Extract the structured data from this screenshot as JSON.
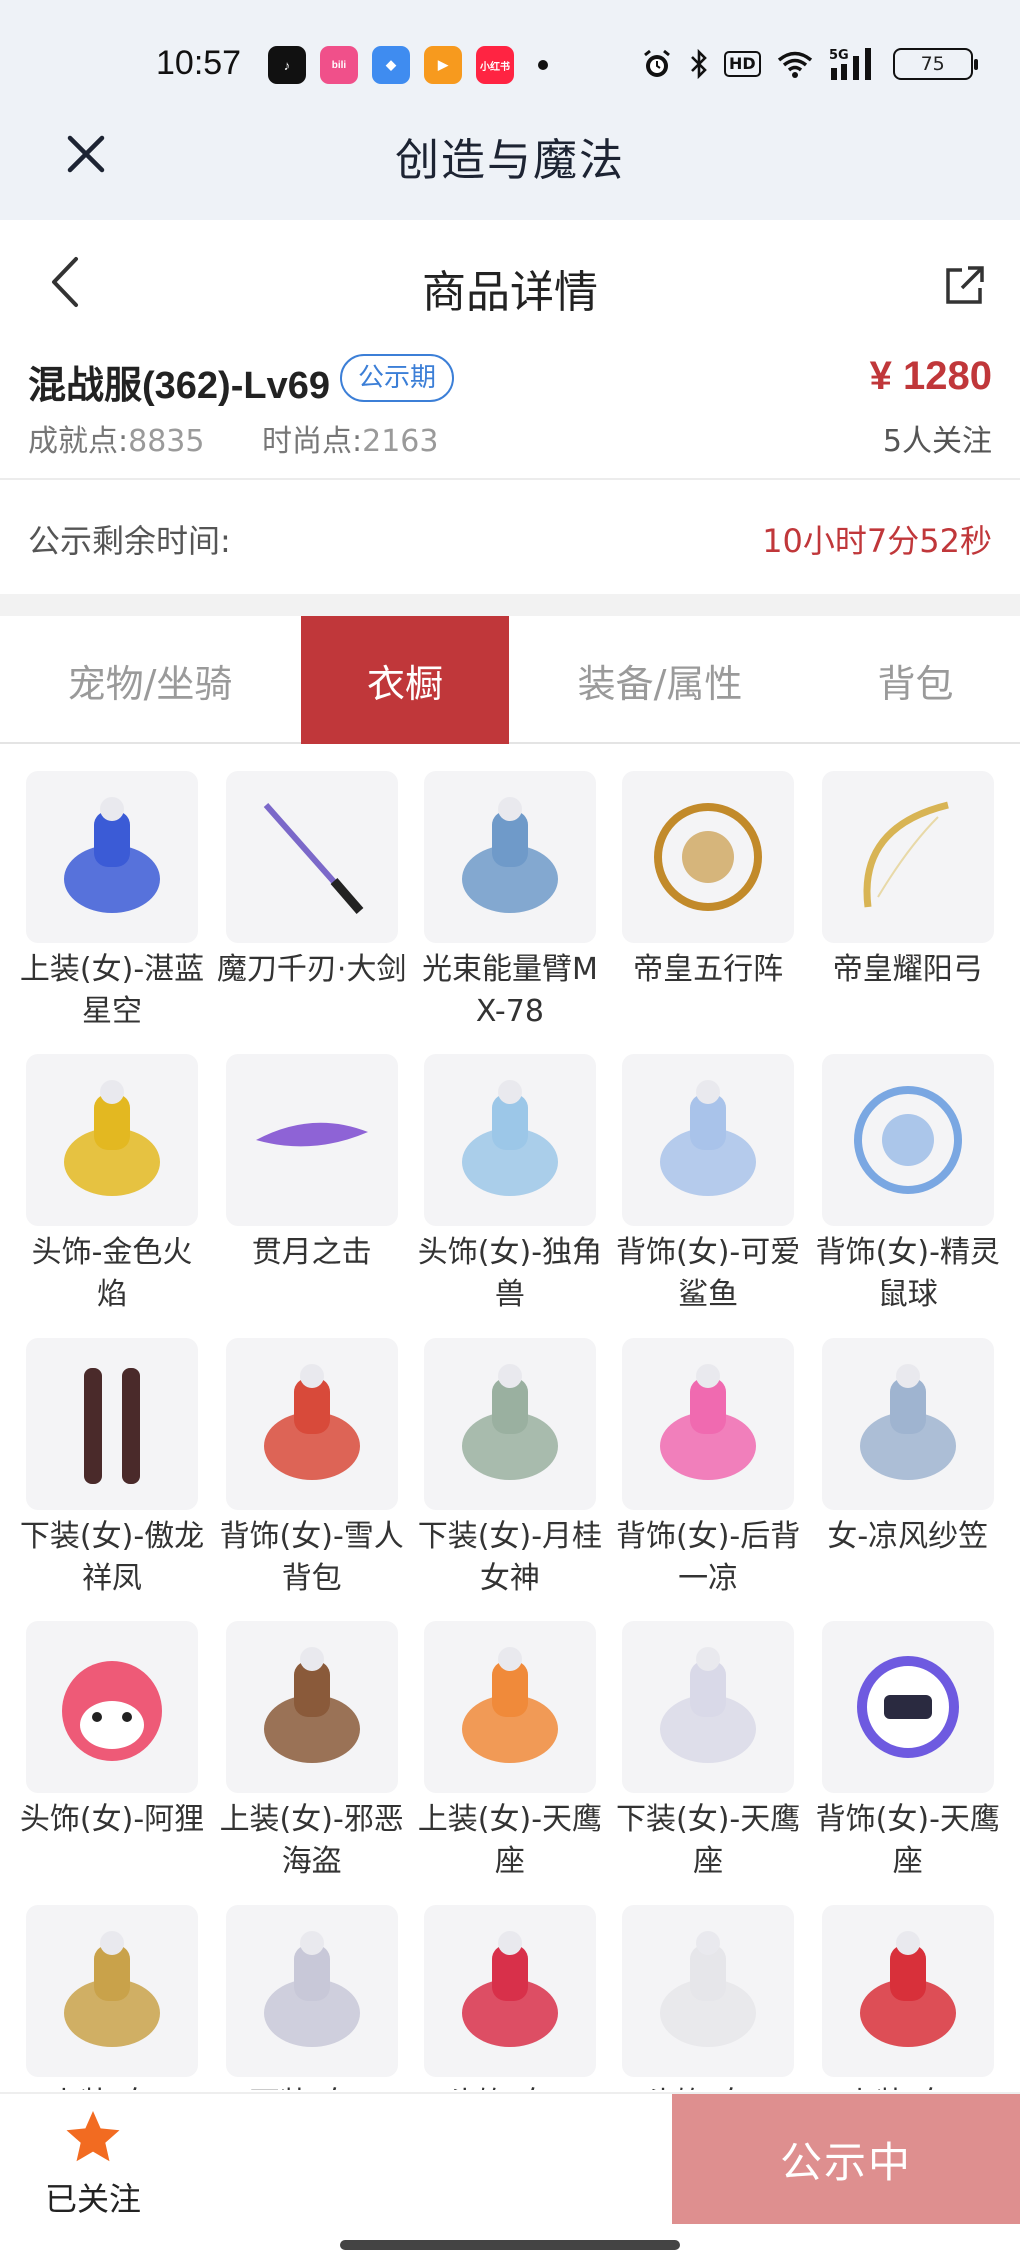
{
  "status_bar": {
    "time": "10:57",
    "apps": [
      {
        "name": "tiktok",
        "color": "#111111",
        "glyph": "♪"
      },
      {
        "name": "bilibili",
        "color": "#f0508a",
        "glyph": "bili"
      },
      {
        "name": "browser",
        "color": "#3f8cf0",
        "glyph": "◆"
      },
      {
        "name": "video",
        "color": "#f79a1e",
        "glyph": "▶"
      },
      {
        "name": "xiaohongshu",
        "color": "#ff2442",
        "glyph": "小红书"
      }
    ],
    "battery": "75"
  },
  "app_bar": {
    "title": "创造与魔法"
  },
  "header": {
    "title": "商品详情"
  },
  "product": {
    "name": "混战服(362)-Lv69",
    "badge": "公示期",
    "price": "¥ 1280",
    "achievement_label": "成就点:",
    "achievement_value": "8835",
    "fashion_label": "时尚点:",
    "fashion_value": "2163",
    "followers": "5人关注"
  },
  "timer": {
    "label": "公示剩余时间:",
    "value": "10小时7分52秒"
  },
  "tabs": [
    {
      "label": "宠物/坐骑",
      "active": false
    },
    {
      "label": "衣橱",
      "active": true
    },
    {
      "label": "装备/属性",
      "active": false
    },
    {
      "label": "背包",
      "active": false
    }
  ],
  "items": [
    {
      "label": "上装(女)-湛蓝星空",
      "icon": "blue-dress-icon",
      "color": "#3b5bd6"
    },
    {
      "label": "魔刀千刃·大剑",
      "icon": "katana-icon",
      "color": "#7b68c9"
    },
    {
      "label": "光束能量臂MX-78",
      "icon": "arm-cannon-icon",
      "color": "#6f9ac9"
    },
    {
      "label": "帝皇五行阵",
      "icon": "five-elements-icon",
      "color": "#c28a2a"
    },
    {
      "label": "帝皇耀阳弓",
      "icon": "golden-bow-icon",
      "color": "#d8b454"
    },
    {
      "label": "头饰-金色火焰",
      "icon": "gold-helmet-icon",
      "color": "#e3b821"
    },
    {
      "label": "贯月之击",
      "icon": "purple-glider-icon",
      "color": "#8e63d6"
    },
    {
      "label": "头饰(女)-独角兽",
      "icon": "unicorn-hood-icon",
      "color": "#9cc7e8"
    },
    {
      "label": "背饰(女)-可爱鲨鱼",
      "icon": "shark-icon",
      "color": "#a9c3ea"
    },
    {
      "label": "背饰(女)-精灵鼠球",
      "icon": "mouse-ball-icon",
      "color": "#7aa7e2"
    },
    {
      "label": "下装(女)-傲龙祥凤",
      "icon": "dark-leggings-icon",
      "color": "#4a2a2a"
    },
    {
      "label": "背饰(女)-雪人背包",
      "icon": "snowman-icon",
      "color": "#d84a3a"
    },
    {
      "label": "下装(女)-月桂女神",
      "icon": "laurel-skirt-icon",
      "color": "#9ab0a0"
    },
    {
      "label": "背饰(女)-后背一凉",
      "icon": "ice-cream-icon",
      "color": "#f06ab0"
    },
    {
      "label": "女-凉风纱笠",
      "icon": "veil-hat-icon",
      "color": "#9fb4d0"
    },
    {
      "label": "头饰(女)-阿狸",
      "icon": "ahri-mask-icon",
      "color": "#ee5a77"
    },
    {
      "label": "上装(女)-邪恶海盗",
      "icon": "pirate-vest-icon",
      "color": "#8a5a3a"
    },
    {
      "label": "上装(女)-天鹰座",
      "icon": "aquila-jacket-icon",
      "color": "#f08a3a"
    },
    {
      "label": "下装(女)-天鹰座",
      "icon": "aquila-pants-icon",
      "color": "#d9d9e8"
    },
    {
      "label": "背饰(女)-天鹰座",
      "icon": "aquila-pack-icon",
      "color": "#6e5ae0"
    },
    {
      "label": "上装(女)-",
      "icon": "gold-dress-icon",
      "color": "#c9a24a"
    },
    {
      "label": "下装(女)-",
      "icon": "white-boots-icon",
      "color": "#c8c8d8"
    },
    {
      "label": "头饰(女)-",
      "icon": "heart-headband-icon",
      "color": "#d8304a"
    },
    {
      "label": "头饰(女)-",
      "icon": "bunny-hair-icon",
      "color": "#e6e6ea"
    },
    {
      "label": "上装(女)-",
      "icon": "red-jacket-icon",
      "color": "#d8303a"
    }
  ],
  "bottom_bar": {
    "follow_label": "已关注",
    "cta_label": "公示中"
  }
}
